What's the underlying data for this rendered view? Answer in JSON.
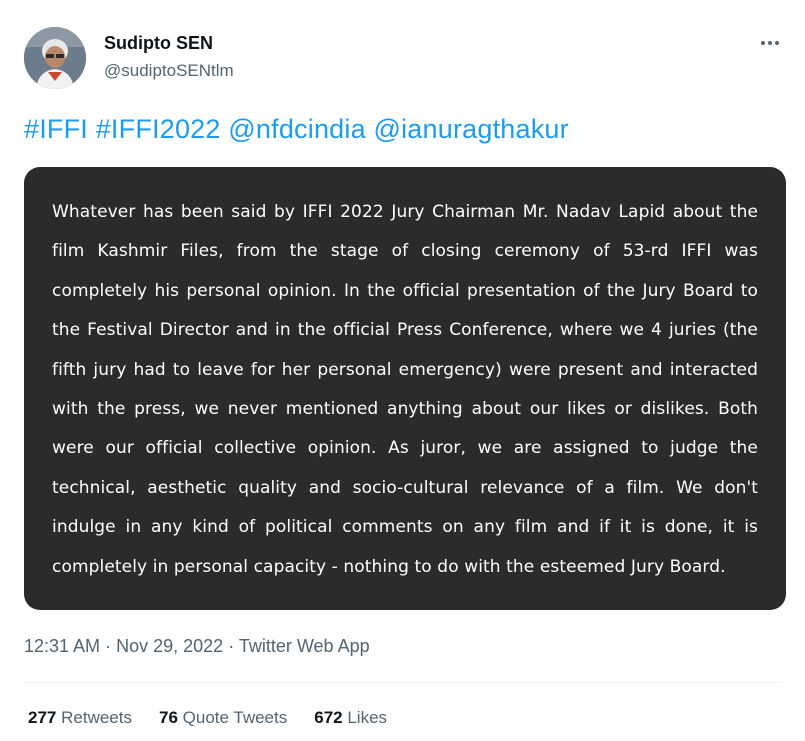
{
  "author": {
    "name": "Sudipto SEN",
    "handle": "@sudiptoSENtlm"
  },
  "tweet": {
    "tags": [
      "#IFFI",
      "#IFFI2022",
      "@nfdcindia",
      "@ianuragthakur"
    ],
    "image_text": "Whatever has been said by IFFI 2022 Jury Chairman Mr. Nadav Lapid about the film Kashmir Files, from the stage of closing ceremony of 53-rd IFFI was completely his personal opinion. In the official presentation of the Jury Board to the Festival Director and in the official Press Conference, where we 4 juries (the fifth jury had to leave for her personal emergency) were present and interacted with the press, we never mentioned anything about our likes or dislikes. Both were our official collective opinion. As juror, we are assigned to judge the technical, aesthetic quality and socio-cultural relevance of a film. We don't indulge in any kind of political comments on any film and if it is done, it is completely in personal capacity - nothing to do with the esteemed Jury Board."
  },
  "meta": {
    "time": "12:31 AM",
    "sep1": "·",
    "date": "Nov 29, 2022",
    "sep2": "·",
    "source": "Twitter Web App"
  },
  "stats": {
    "retweets_count": "277",
    "retweets_label": "Retweets",
    "quotes_count": "76",
    "quotes_label": "Quote Tweets",
    "likes_count": "672",
    "likes_label": "Likes"
  },
  "icons": {
    "more": "more-horizontal-icon",
    "avatar": "avatar"
  },
  "colors": {
    "link": "#1d9bf0",
    "secondary_text": "#536471",
    "media_bg": "#2b2b2b"
  }
}
